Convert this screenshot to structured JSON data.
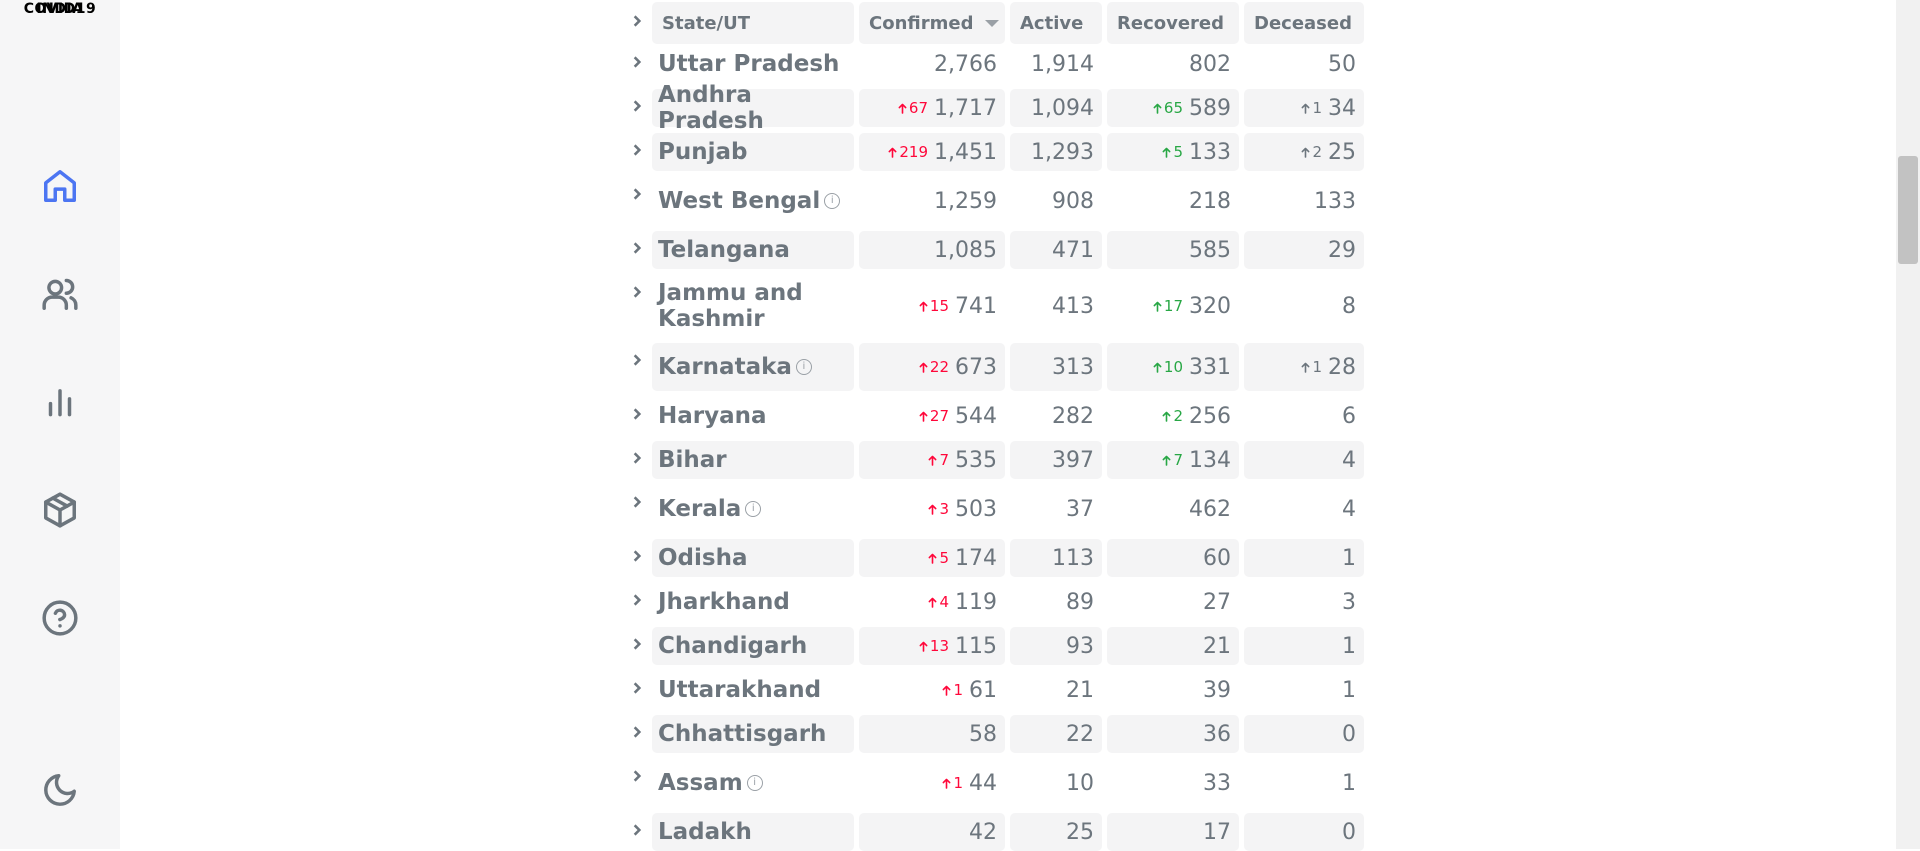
{
  "logo": {
    "line1": "COVID19",
    "line2": "INDIA"
  },
  "nav": [
    {
      "name": "home-icon"
    },
    {
      "name": "users-icon"
    },
    {
      "name": "bar-chart-icon"
    },
    {
      "name": "package-icon"
    },
    {
      "name": "help-icon"
    },
    {
      "name": "moon-icon"
    }
  ],
  "header": {
    "state": "State/UT",
    "confirmed": "Confirmed",
    "active": "Active",
    "recovered": "Recovered",
    "deceased": "Deceased"
  },
  "rows": [
    {
      "state": "Uttar Pradesh",
      "info": false,
      "confirmed": "2,766",
      "active": "1,914",
      "recovered": "802",
      "deceased": "50"
    },
    {
      "state": "Andhra Pradesh",
      "info": false,
      "conf_delta": "67",
      "confirmed": "1,717",
      "active": "1,094",
      "rec_delta": "65",
      "recovered": "589",
      "dec_delta": "1",
      "deceased": "34"
    },
    {
      "state": "Punjab",
      "info": false,
      "conf_delta": "219",
      "confirmed": "1,451",
      "active": "1,293",
      "rec_delta": "5",
      "recovered": "133",
      "dec_delta": "2",
      "deceased": "25"
    },
    {
      "state": "West Bengal",
      "info": true,
      "confirmed": "1,259",
      "active": "908",
      "recovered": "218",
      "deceased": "133"
    },
    {
      "state": "Telangana",
      "info": false,
      "confirmed": "1,085",
      "active": "471",
      "recovered": "585",
      "deceased": "29"
    },
    {
      "state": "Jammu and Kashmir",
      "info": false,
      "conf_delta": "15",
      "confirmed": "741",
      "active": "413",
      "rec_delta": "17",
      "recovered": "320",
      "deceased": "8"
    },
    {
      "state": "Karnataka",
      "info": true,
      "conf_delta": "22",
      "confirmed": "673",
      "active": "313",
      "rec_delta": "10",
      "recovered": "331",
      "dec_delta": "1",
      "deceased": "28"
    },
    {
      "state": "Haryana",
      "info": false,
      "conf_delta": "27",
      "confirmed": "544",
      "active": "282",
      "rec_delta": "2",
      "recovered": "256",
      "deceased": "6"
    },
    {
      "state": "Bihar",
      "info": false,
      "conf_delta": "7",
      "confirmed": "535",
      "active": "397",
      "rec_delta": "7",
      "recovered": "134",
      "deceased": "4"
    },
    {
      "state": "Kerala",
      "info": true,
      "conf_delta": "3",
      "confirmed": "503",
      "active": "37",
      "recovered": "462",
      "deceased": "4"
    },
    {
      "state": "Odisha",
      "info": false,
      "conf_delta": "5",
      "confirmed": "174",
      "active": "113",
      "recovered": "60",
      "deceased": "1"
    },
    {
      "state": "Jharkhand",
      "info": false,
      "conf_delta": "4",
      "confirmed": "119",
      "active": "89",
      "recovered": "27",
      "deceased": "3"
    },
    {
      "state": "Chandigarh",
      "info": false,
      "conf_delta": "13",
      "confirmed": "115",
      "active": "93",
      "recovered": "21",
      "deceased": "1"
    },
    {
      "state": "Uttarakhand",
      "info": false,
      "conf_delta": "1",
      "confirmed": "61",
      "active": "21",
      "recovered": "39",
      "deceased": "1"
    },
    {
      "state": "Chhattisgarh",
      "info": false,
      "confirmed": "58",
      "active": "22",
      "recovered": "36",
      "deceased": "0"
    },
    {
      "state": "Assam",
      "info": true,
      "conf_delta": "1",
      "confirmed": "44",
      "active": "10",
      "recovered": "33",
      "deceased": "1"
    },
    {
      "state": "Ladakh",
      "info": false,
      "confirmed": "42",
      "active": "25",
      "recovered": "17",
      "deceased": "0"
    }
  ],
  "colors": {
    "confirmed_delta": "#ff073a",
    "recovered_delta": "#28a745",
    "deceased_delta": "#6c757d",
    "accent": "#4c75f2"
  }
}
